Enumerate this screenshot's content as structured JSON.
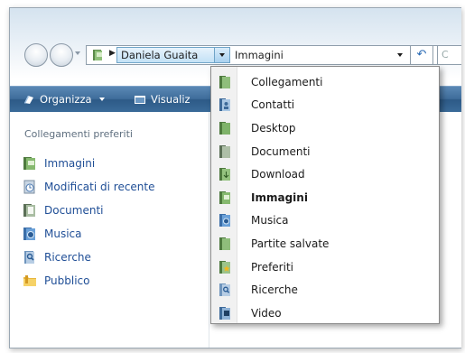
{
  "address_bar": {
    "crumb_active": "Daniela Guaita",
    "crumb_current": "Immagini"
  },
  "search": {
    "placeholder": "C"
  },
  "toolbar": {
    "organize_label": "Organizza",
    "view_label": "Visualiz"
  },
  "nav_pane": {
    "heading": "Collegamenti preferiti",
    "items": [
      {
        "label": "Immagini",
        "icon": "pictures-icon"
      },
      {
        "label": "Modificati di recente",
        "icon": "recent-icon"
      },
      {
        "label": "Documenti",
        "icon": "documents-icon"
      },
      {
        "label": "Musica",
        "icon": "music-icon"
      },
      {
        "label": "Ricerche",
        "icon": "searches-icon"
      },
      {
        "label": "Pubblico",
        "icon": "public-folder-icon"
      }
    ]
  },
  "dropdown_menu": {
    "selected": "Immagini",
    "items": [
      {
        "label": "Collegamenti",
        "icon": "links-icon"
      },
      {
        "label": "Contatti",
        "icon": "contacts-icon"
      },
      {
        "label": "Desktop",
        "icon": "desktop-icon"
      },
      {
        "label": "Documenti",
        "icon": "documents-icon"
      },
      {
        "label": "Download",
        "icon": "downloads-icon"
      },
      {
        "label": "Immagini",
        "icon": "pictures-icon"
      },
      {
        "label": "Musica",
        "icon": "music-icon"
      },
      {
        "label": "Partite salvate",
        "icon": "saved-games-icon"
      },
      {
        "label": "Preferiti",
        "icon": "favorites-icon"
      },
      {
        "label": "Ricerche",
        "icon": "searches-icon"
      },
      {
        "label": "Video",
        "icon": "videos-icon"
      }
    ]
  },
  "colors": {
    "link_blue": "#1f4e96",
    "toolbar_blue": "#3f6d9b",
    "highlight_blue": "#c3e1f6"
  }
}
